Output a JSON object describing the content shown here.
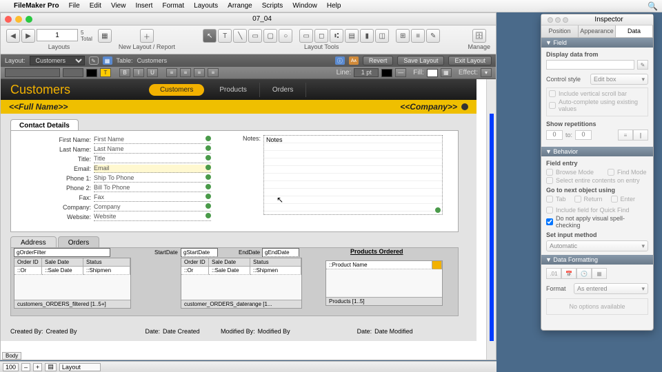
{
  "menubar": {
    "app": "FileMaker Pro",
    "items": [
      "File",
      "Edit",
      "View",
      "Insert",
      "Format",
      "Layouts",
      "Arrange",
      "Scripts",
      "Window",
      "Help"
    ]
  },
  "window": {
    "title": "07_04"
  },
  "toolbar": {
    "page": "1",
    "total_label": "Total",
    "total": "5",
    "group_layouts": "Layouts",
    "group_newlayout": "New Layout / Report",
    "group_tools": "Layout Tools",
    "group_manage": "Manage"
  },
  "layoutbar": {
    "layout_label": "Layout:",
    "layout": "Customers",
    "table_label": "Table:",
    "table": "Customers",
    "btn_revert": "Revert",
    "btn_save": "Save Layout",
    "btn_exit": "Exit Layout"
  },
  "formatbar": {
    "line_label": "Line:",
    "line_pt": "1 pt",
    "fill_label": "Fill:",
    "effect_label": "Effect:"
  },
  "layout": {
    "title": "Customers",
    "tabs": [
      "Customers",
      "Products",
      "Orders"
    ],
    "fullname": "<<Full Name>>",
    "company": "<<Company>>",
    "contact_tab": "Contact Details",
    "fields": {
      "first_label": "First Name:",
      "first": "First Name",
      "last_label": "Last Name:",
      "last": "Last Name",
      "title_label": "Title:",
      "title": "Title",
      "email_label": "Email:",
      "email": "Email",
      "phone1_label": "Phone 1:",
      "phone1": "Ship To Phone",
      "phone2_label": "Phone 2:",
      "phone2": "Bill To Phone",
      "fax_label": "Fax:",
      "fax": "Fax",
      "company_label": "Company:",
      "company": "Company",
      "website_label": "Website:",
      "website": "Website",
      "notes_label": "Notes:",
      "notes": "Notes"
    },
    "subtabs": [
      "Address",
      "Orders"
    ],
    "filter_field": "gOrderFilter",
    "start_label": "StartDate",
    "start_field": "gStartDate",
    "end_label": "EndDate",
    "end_field": "gEndDate",
    "products_title": "Products Ordered",
    "portal1": {
      "cols": [
        "Order ID",
        "Sale Date",
        "Status"
      ],
      "row": [
        "::Or",
        "::Sale Date",
        "::Shipmen"
      ],
      "foot": "customers_ORDERS_filtered [1..5+]"
    },
    "portal2": {
      "cols": [
        "Order ID",
        "Sale Date",
        "Status"
      ],
      "row": [
        "::Or",
        "::Sale Date",
        "::Shipmen"
      ],
      "foot": "customer_ORDERS_daterange [1..."
    },
    "portal3": {
      "row": "::Product Name",
      "foot": "Products [1..5]"
    },
    "footer": {
      "created_label": "Created By:",
      "created": "Created By",
      "date1_label": "Date:",
      "date1": "Date Created",
      "modified_label": "Modified By:",
      "modified": "Modified By",
      "date2_label": "Date:",
      "date2": "Date Modified"
    },
    "part": "Body"
  },
  "statusbar": {
    "zoom": "100",
    "mode": "Layout"
  },
  "inspector": {
    "title": "Inspector",
    "tabs": [
      "Position",
      "Appearance",
      "Data"
    ],
    "sec_field": "Field",
    "display_label": "Display data from",
    "control_label": "Control style",
    "control": "Edit box",
    "scroll": "Include vertical scroll bar",
    "autoc": "Auto-complete using existing values",
    "showrep": "Show repetitions",
    "rep_to": "to:",
    "rep_from": "0",
    "rep_to_v": "0",
    "sec_behavior": "Behavior",
    "entry_label": "Field entry",
    "browse": "Browse Mode",
    "find": "Find Mode",
    "select_entire": "Select entire contents on entry",
    "goto_label": "Go to next object using",
    "tab": "Tab",
    "return": "Return",
    "enter": "Enter",
    "quickfind": "Include field for Quick Find",
    "spell": "Do not apply visual spell-checking",
    "input_label": "Set input method",
    "input": "Automatic",
    "sec_format": "Data Formatting",
    "format_label": "Format",
    "format": "As entered",
    "noopts": "No options available"
  }
}
